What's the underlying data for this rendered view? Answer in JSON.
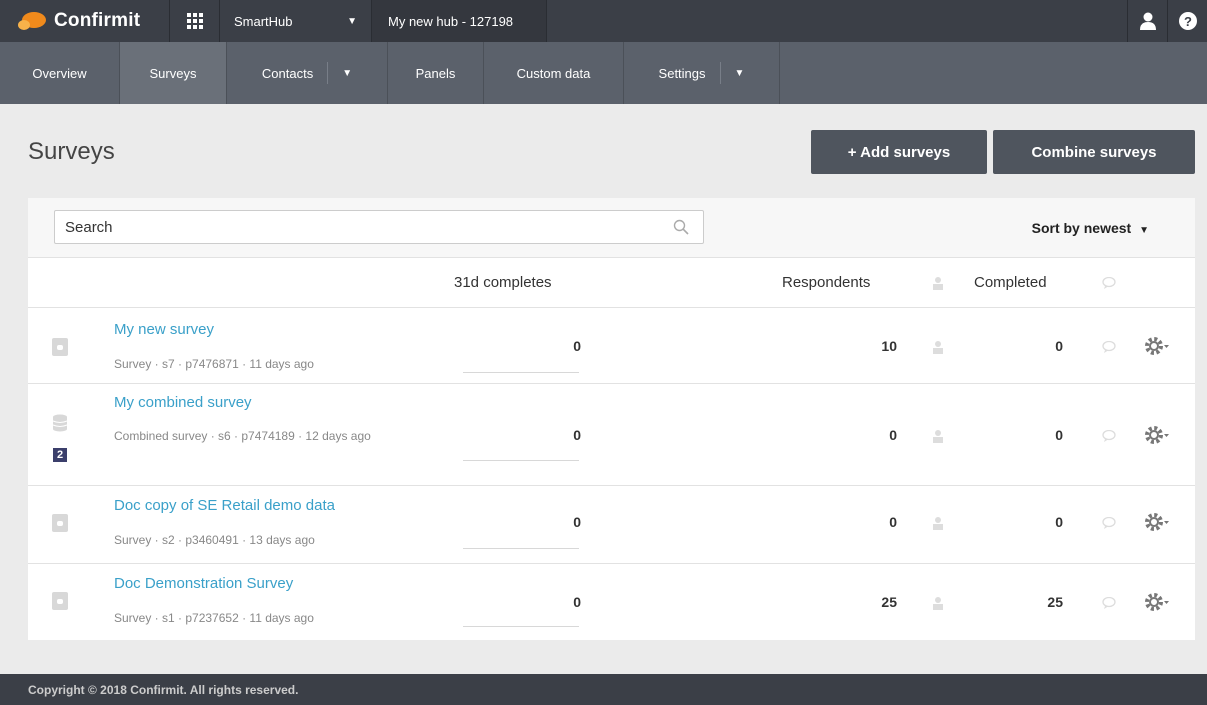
{
  "topbar": {
    "brand": "Confirmit",
    "hub_selector": "SmartHub",
    "hub_name": "My new hub - 127198"
  },
  "nav": {
    "items": [
      {
        "label": "Overview"
      },
      {
        "label": "Surveys",
        "active": true
      },
      {
        "label": "Contacts",
        "dropdown": true
      },
      {
        "label": "Panels"
      },
      {
        "label": "Custom data"
      },
      {
        "label": "Settings",
        "dropdown": true
      }
    ]
  },
  "page": {
    "title": "Surveys",
    "add_button": "+ Add surveys",
    "combine_button": "Combine surveys"
  },
  "search": {
    "placeholder": "Search"
  },
  "sort": {
    "label": "Sort by newest"
  },
  "table": {
    "headers": {
      "completes": "31d completes",
      "respondents": "Respondents",
      "completed": "Completed"
    },
    "rows": [
      {
        "title": "My new survey",
        "meta": "Survey · s7 · p7476871 · 11 days ago",
        "completes": "0",
        "respondents": "10",
        "completed": "0",
        "icon": "survey-icon"
      },
      {
        "title": "My combined survey",
        "meta": "Combined survey · s6 · p7474189 · 12 days ago",
        "completes": "0",
        "respondents": "0",
        "completed": "0",
        "icon": "database-icon",
        "badge": "2"
      },
      {
        "title": "Doc copy of SE Retail demo data",
        "meta": "Survey · s2 · p3460491 · 13 days ago",
        "completes": "0",
        "respondents": "0",
        "completed": "0",
        "icon": "survey-icon"
      },
      {
        "title": "Doc Demonstration Survey",
        "meta": "Survey · s1 · p7237652 · 11 days ago",
        "completes": "0",
        "respondents": "25",
        "completed": "25",
        "icon": "survey-icon"
      }
    ]
  },
  "footer": {
    "text": "Copyright © 2018 Confirmit. All rights reserved."
  },
  "colors": {
    "topbar": "#3b3f47",
    "navbar": "#5b616b",
    "link": "#3aa0c9",
    "button": "#4f555e",
    "brand_orange": "#f08a1c"
  }
}
